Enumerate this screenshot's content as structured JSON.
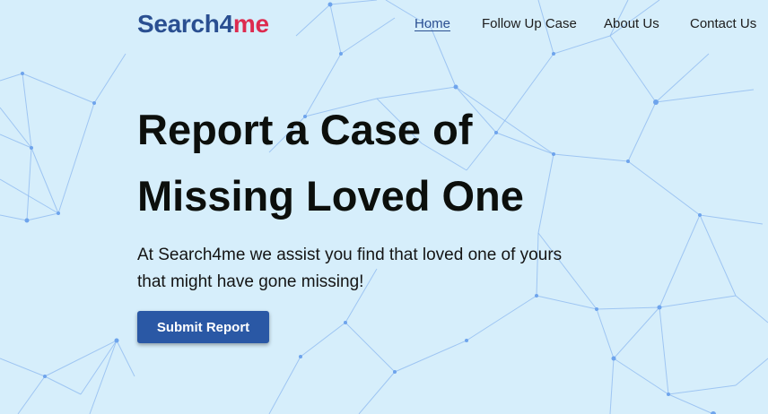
{
  "header": {
    "logo_part1": "Search4",
    "logo_part2": "me",
    "nav": [
      {
        "label": "Home",
        "active": true
      },
      {
        "label": "Follow Up Case",
        "active": false
      },
      {
        "label": "About Us",
        "active": false
      },
      {
        "label": "Contact Us",
        "active": false
      }
    ]
  },
  "hero": {
    "title_line1": "Report a Case of",
    "title_line2": "Missing Loved One",
    "subtitle_line1": "At Search4me we assist you find that loved one of yours",
    "subtitle_line2": "that might have gone missing!",
    "cta_label": "Submit Report"
  },
  "colors": {
    "background": "#d6eefb",
    "brand_blue": "#2a4f91",
    "brand_red": "#dd2b4f",
    "button": "#2a58a5",
    "network_lines": "#8cb8f0"
  }
}
